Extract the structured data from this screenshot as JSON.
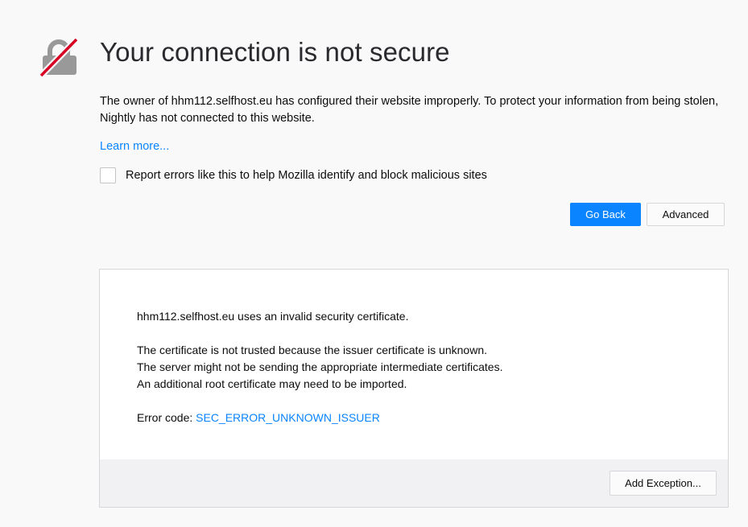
{
  "icons": {
    "lock": "broken-lock-icon",
    "lock_color": "#999999",
    "slash_color": "#d70022"
  },
  "header": {
    "title": "Your connection is not secure"
  },
  "description": {
    "text": "The owner of hhm112.selfhost.eu has configured their website improperly. To protect your information from being stolen, Nightly has not connected to this website."
  },
  "learn_more": {
    "label": "Learn more..."
  },
  "report": {
    "label": "Report errors like this to help Mozilla identify and block malicious sites",
    "checked": false
  },
  "actions": {
    "go_back_label": "Go Back",
    "advanced_label": "Advanced"
  },
  "advanced_panel": {
    "line1": "hhm112.selfhost.eu uses an invalid security certificate.",
    "line2": "The certificate is not trusted because the issuer certificate is unknown.",
    "line3": "The server might not be sending the appropriate intermediate certificates.",
    "line4": "An additional root certificate may need to be imported.",
    "error_code_prefix": "Error code: ",
    "error_code": "SEC_ERROR_UNKNOWN_ISSUER",
    "add_exception_label": "Add Exception..."
  },
  "colors": {
    "accent": "#0a84ff",
    "background": "#f9f9fa",
    "panel_footer": "#f1f1f3"
  }
}
